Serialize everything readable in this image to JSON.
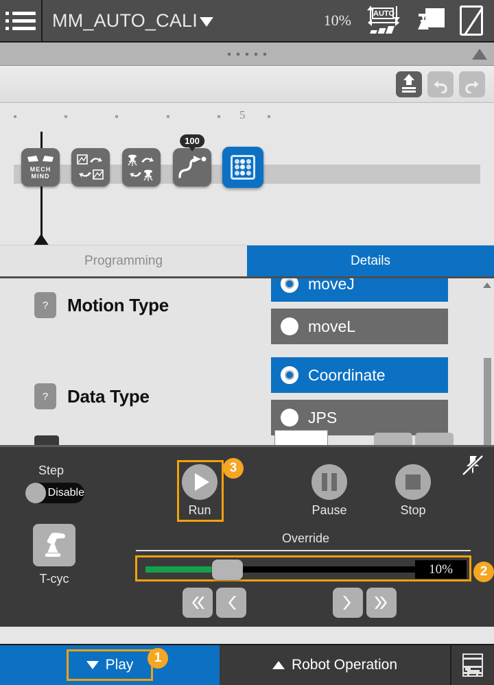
{
  "header": {
    "menu_icon": "hamburger-menu-icon",
    "project_name": "MM_AUTO_CALI",
    "project_dropdown_icon": "caret-down-icon",
    "speed_percent": "10%",
    "mode_icon": "auto-mode-icon",
    "mode_label": "AUTO",
    "tool_icon": "robot-tool-icon",
    "teach_pendant_icon": "no-pendant-icon"
  },
  "splitter": {
    "grip_icon": "drag-grip-dots",
    "collapse_icon": "collapse-up-triangle-icon"
  },
  "edit_toolbar": {
    "buttons": [
      {
        "name": "upload-icon",
        "state": "enabled"
      },
      {
        "name": "undo-icon",
        "state": "disabled"
      },
      {
        "name": "redo-icon",
        "state": "disabled"
      }
    ]
  },
  "ruler": {
    "labels": [
      "5"
    ],
    "tick_count": 7
  },
  "program": {
    "cursor_icon": "playhead-marker",
    "nodes": [
      {
        "name": "mech-mind-node",
        "label": "MECH\nMIND",
        "icon": "mech-mind-logo-icon",
        "selected": false,
        "badge": ""
      },
      {
        "name": "vision-swap-node",
        "label": "",
        "icon": "vision-exchange-icon",
        "selected": false,
        "badge": ""
      },
      {
        "name": "robot-swap-node",
        "label": "",
        "icon": "robot-exchange-icon",
        "selected": false,
        "badge": ""
      },
      {
        "name": "move-node",
        "label": "",
        "icon": "move-path-icon",
        "selected": false,
        "badge": "100"
      },
      {
        "name": "grid-node",
        "label": "",
        "icon": "dot-grid-icon",
        "selected": true,
        "badge": ""
      }
    ]
  },
  "tabs": [
    {
      "label": "Programming",
      "active": false,
      "name": "tab-programming"
    },
    {
      "label": "Details",
      "active": true,
      "name": "tab-details"
    }
  ],
  "details": {
    "rows": [
      {
        "label": "Motion Type",
        "help_icon": "question-mark-icon",
        "options": [
          {
            "label": "moveJ",
            "selected": true
          },
          {
            "label": "moveL",
            "selected": false
          }
        ]
      },
      {
        "label": "Data Type",
        "help_icon": "question-mark-icon",
        "options": [
          {
            "label": "Coordinate",
            "selected": true
          },
          {
            "label": "JPS",
            "selected": false
          }
        ]
      }
    ],
    "scrollbar": "vertical-scrollbar"
  },
  "control": {
    "step": {
      "label": "Step",
      "toggle_value": "Disable",
      "toggle_state": "off"
    },
    "tcyc": {
      "label": "T-cyc",
      "icon": "robot-arm-icon"
    },
    "buttons": [
      {
        "label": "Run",
        "name": "run-button",
        "icon": "play-icon",
        "highlighted": true,
        "badge": "3"
      },
      {
        "label": "Pause",
        "name": "pause-button",
        "icon": "pause-icon",
        "highlighted": false,
        "badge": ""
      },
      {
        "label": "Stop",
        "name": "stop-button",
        "icon": "stop-icon",
        "highlighted": false,
        "badge": ""
      }
    ],
    "override": {
      "label": "Override",
      "value": "10%",
      "percent": 10,
      "highlighted": true,
      "badge": "2"
    },
    "nav": [
      {
        "name": "first-button",
        "icon": "double-chevron-left-icon"
      },
      {
        "name": "prev-button",
        "icon": "chevron-left-icon"
      },
      {
        "name": "next-button",
        "icon": "chevron-right-icon"
      },
      {
        "name": "last-button",
        "icon": "double-chevron-right-icon"
      }
    ],
    "pin_icon": "pin-off-icon"
  },
  "bottom_bar": {
    "play": {
      "label": "Play",
      "icon": "triangle-down-icon",
      "badge": "1"
    },
    "robot_operation": {
      "label": "Robot Operation",
      "icon": "triangle-up-icon"
    },
    "window_icon": "window-layout-icon"
  },
  "colors": {
    "accent_blue": "#0c71c3",
    "highlight_orange": "#f2a20c",
    "badge_orange": "#f5a623",
    "panel_dark": "#3a3a3a",
    "header_dark": "#4d4d4d",
    "slider_green": "#17a04b"
  }
}
